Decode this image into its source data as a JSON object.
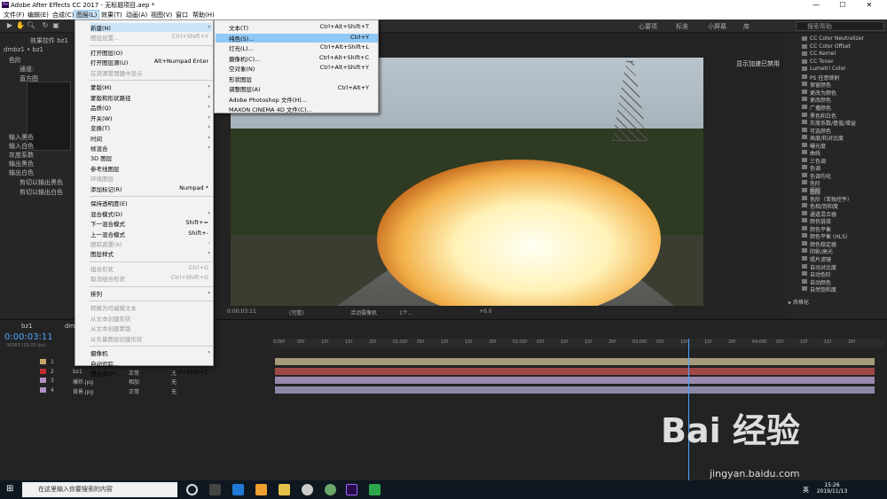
{
  "window": {
    "title": "Adobe After Effects CC 2017 - 无标题项目.aep *",
    "ae_logo": "Ae",
    "min": "—",
    "max": "☐",
    "close": "✕"
  },
  "menubar": [
    "文件(F)",
    "编辑(E)",
    "合成(C)",
    "图层(L)",
    "效果(T)",
    "动画(A)",
    "视图(V)",
    "窗口",
    "帮助(H)"
  ],
  "workspaces": [
    "心要项",
    "标准",
    "小屏幕",
    "库"
  ],
  "search_help": "搜索帮助",
  "left_panel": {
    "tab": "效果控件 bz1",
    "layer": "dmbz1 • bz1",
    "fx": "色阶",
    "channel": "通道:",
    "histogram": "直方图",
    "rows": [
      "输入黑色",
      "输入白色",
      "灰度系数",
      "输出黑色",
      "输出白色"
    ],
    "clip1": "剪切以输出黑色",
    "clip2": "剪切以输出白色"
  },
  "viewer": {
    "gpu_label": "显示加速已禁用",
    "zoom": "(完整)",
    "camera": "活动摄像机",
    "views": "1个...",
    "exposure": "+0.0",
    "time": "0:00:03:11"
  },
  "layer_menu": [
    {
      "label": "新建(N)",
      "arrow": "›",
      "hover": true
    },
    {
      "label": "图层设置...",
      "sc": "Ctrl+Shift+Y",
      "dis": true
    },
    {
      "sep": true
    },
    {
      "label": "打开图层(O)"
    },
    {
      "label": "打开图层源(U)",
      "sc": "Alt+Numpad Enter"
    },
    {
      "label": "在资源管理器中显示",
      "dis": true
    },
    {
      "sep": true
    },
    {
      "label": "蒙版(M)",
      "arrow": "›"
    },
    {
      "label": "蒙版和形状路径",
      "arrow": "›"
    },
    {
      "label": "品质(Q)",
      "arrow": "›"
    },
    {
      "label": "开关(W)",
      "arrow": "›"
    },
    {
      "label": "变换(T)",
      "arrow": "›"
    },
    {
      "label": "时间",
      "arrow": "›"
    },
    {
      "label": "帧混合",
      "arrow": "›"
    },
    {
      "label": "3D 图层"
    },
    {
      "label": "参考线图层"
    },
    {
      "label": "环境图层",
      "dis": true
    },
    {
      "label": "添加标记(R)",
      "sc": "Numpad *"
    },
    {
      "sep": true
    },
    {
      "label": "保持透明度(E)"
    },
    {
      "label": "混合模式(D)",
      "arrow": "›"
    },
    {
      "label": "下一混合模式",
      "sc": "Shift+="
    },
    {
      "label": "上一混合模式",
      "sc": "Shift+-"
    },
    {
      "label": "跟踪遮罩(A)",
      "arrow": "›",
      "dis": true
    },
    {
      "label": "图层样式",
      "arrow": "›"
    },
    {
      "sep": true
    },
    {
      "label": "组合形状",
      "sc": "Ctrl+G",
      "dis": true
    },
    {
      "label": "取消组合形状",
      "sc": "Ctrl+Shift+G",
      "dis": true
    },
    {
      "sep": true
    },
    {
      "label": "排列",
      "arrow": "›"
    },
    {
      "sep": true
    },
    {
      "label": "转换为可编辑文本",
      "dis": true
    },
    {
      "label": "从文本创建形状",
      "dis": true
    },
    {
      "label": "从文本创建蒙版",
      "dis": true
    },
    {
      "label": "从矢量图层创建形状",
      "dis": true
    },
    {
      "sep": true
    },
    {
      "label": "摄像机",
      "arrow": "›"
    },
    {
      "label": "自动追踪..."
    },
    {
      "label": "预合成(P)...",
      "sc": "Ctrl+Shift+C"
    }
  ],
  "new_menu": [
    {
      "label": "文本(T)",
      "sc": "Ctrl+Alt+Shift+T"
    },
    {
      "label": "纯色(S)...",
      "sc": "Ctrl+Y",
      "sel": true
    },
    {
      "label": "灯光(L)...",
      "sc": "Ctrl+Alt+Shift+L"
    },
    {
      "label": "摄像机(C)...",
      "sc": "Ctrl+Alt+Shift+C"
    },
    {
      "label": "空对象(N)",
      "sc": "Ctrl+Alt+Shift+Y"
    },
    {
      "label": "形状图层"
    },
    {
      "label": "调整图层(A)",
      "sc": "Ctrl+Alt+Y"
    },
    {
      "label": "Adobe Photoshop 文件(H)..."
    },
    {
      "label": "MAXON CINEMA 4D 文件(C)..."
    }
  ],
  "effects": [
    {
      "t": "CC Color Neutralizer"
    },
    {
      "t": "CC Color Offset"
    },
    {
      "t": "CC Kernel"
    },
    {
      "t": "CC Toner"
    },
    {
      "t": "Lumetri Color"
    },
    {
      "t": "PS 任意映射"
    },
    {
      "t": "保留颜色"
    },
    {
      "t": "更改为颜色"
    },
    {
      "t": "更改颜色"
    },
    {
      "t": "广播颜色"
    },
    {
      "t": "黑色和白色"
    },
    {
      "t": "灰度系数/基值/增益"
    },
    {
      "t": "可选颜色"
    },
    {
      "t": "高度/和对比度"
    },
    {
      "t": "曝光度"
    },
    {
      "t": "曲线"
    },
    {
      "t": "三色调"
    },
    {
      "t": "色调"
    },
    {
      "t": "色调均化"
    },
    {
      "t": "色阶"
    },
    {
      "t": "色阶",
      "hl": true
    },
    {
      "t": "色阶（单独控件）"
    },
    {
      "t": "色相/饱和度"
    },
    {
      "t": "通道混合器"
    },
    {
      "t": "颜色链接"
    },
    {
      "t": "颜色平衡"
    },
    {
      "t": "颜色平衡 (HLS)"
    },
    {
      "t": "颜色稳定器"
    },
    {
      "t": "阴影/高光"
    },
    {
      "t": "照片滤镜"
    },
    {
      "t": "自动对比度"
    },
    {
      "t": "自动色阶"
    },
    {
      "t": "自动颜色"
    },
    {
      "t": "自然饱和度"
    }
  ],
  "effects_footer": "▸ 风格化",
  "timeline": {
    "tab1": "bz1",
    "tab2": "dm",
    "timecode": "0:00:03:11",
    "sub": "00083 (25.00 fps)",
    "ruler": [
      "0:00f",
      "05f",
      "10f",
      "15f",
      "20f",
      "01:00f",
      "05f",
      "10f",
      "15f",
      "20f",
      "02:00f",
      "05f",
      "10f",
      "15f",
      "20f",
      "03:00f",
      "05f",
      "10f",
      "15f",
      "20f",
      "04:00f",
      "05f",
      "10f",
      "15f",
      "20f"
    ],
    "layers": [
      {
        "n": "1",
        "name": "",
        "mode": "",
        "trk": "无",
        "color": "#c9a56a",
        "bar": "#a69a7c"
      },
      {
        "n": "2",
        "name": "bz1",
        "mode": "正常",
        "trk": "无",
        "color": "#c03030",
        "bar": "#a04848"
      },
      {
        "n": "3",
        "name": "爆炸.jpg",
        "mode": "相加",
        "trk": "无",
        "color": "#b090c0",
        "bar": "#9a88ad"
      },
      {
        "n": "4",
        "name": "背景.jpg",
        "mode": "正常",
        "trk": "无",
        "color": "#b090c0",
        "bar": "#8c88a8"
      }
    ]
  },
  "taskbar": {
    "search": "在这里输入你要搜索的内容",
    "time": "15:26",
    "date": "2019/11/13",
    "lang": "英"
  },
  "watermark": {
    "brand": "Bai 经验",
    "url": "jingyan.baidu.com"
  }
}
